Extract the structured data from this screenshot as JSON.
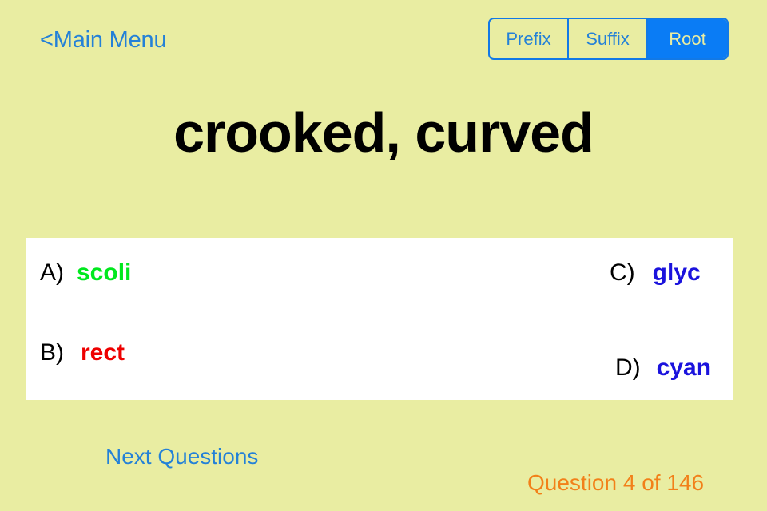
{
  "nav": {
    "back_label": "<Main Menu",
    "segments": [
      {
        "label": "Prefix",
        "selected": false
      },
      {
        "label": "Suffix",
        "selected": false
      },
      {
        "label": "Root",
        "selected": true
      }
    ]
  },
  "quiz": {
    "prompt": "crooked, curved",
    "options": [
      {
        "letter": "A)",
        "word": "scoli",
        "color": "#00e81e"
      },
      {
        "letter": "B)",
        "word": "rect",
        "color": "#ee0000"
      },
      {
        "letter": "C)",
        "word": "glyc",
        "color": "#1b13dd"
      },
      {
        "letter": "D)",
        "word": "cyan",
        "color": "#1b13dd"
      }
    ]
  },
  "footer": {
    "next_label": "Next Questions",
    "counter": "Question 4 of 146"
  },
  "colors": {
    "background": "#e9eda2",
    "panel": "#ffffff",
    "link": "#2481d7",
    "accent_blue": "#0a7cf5",
    "counter_orange": "#f28019"
  }
}
